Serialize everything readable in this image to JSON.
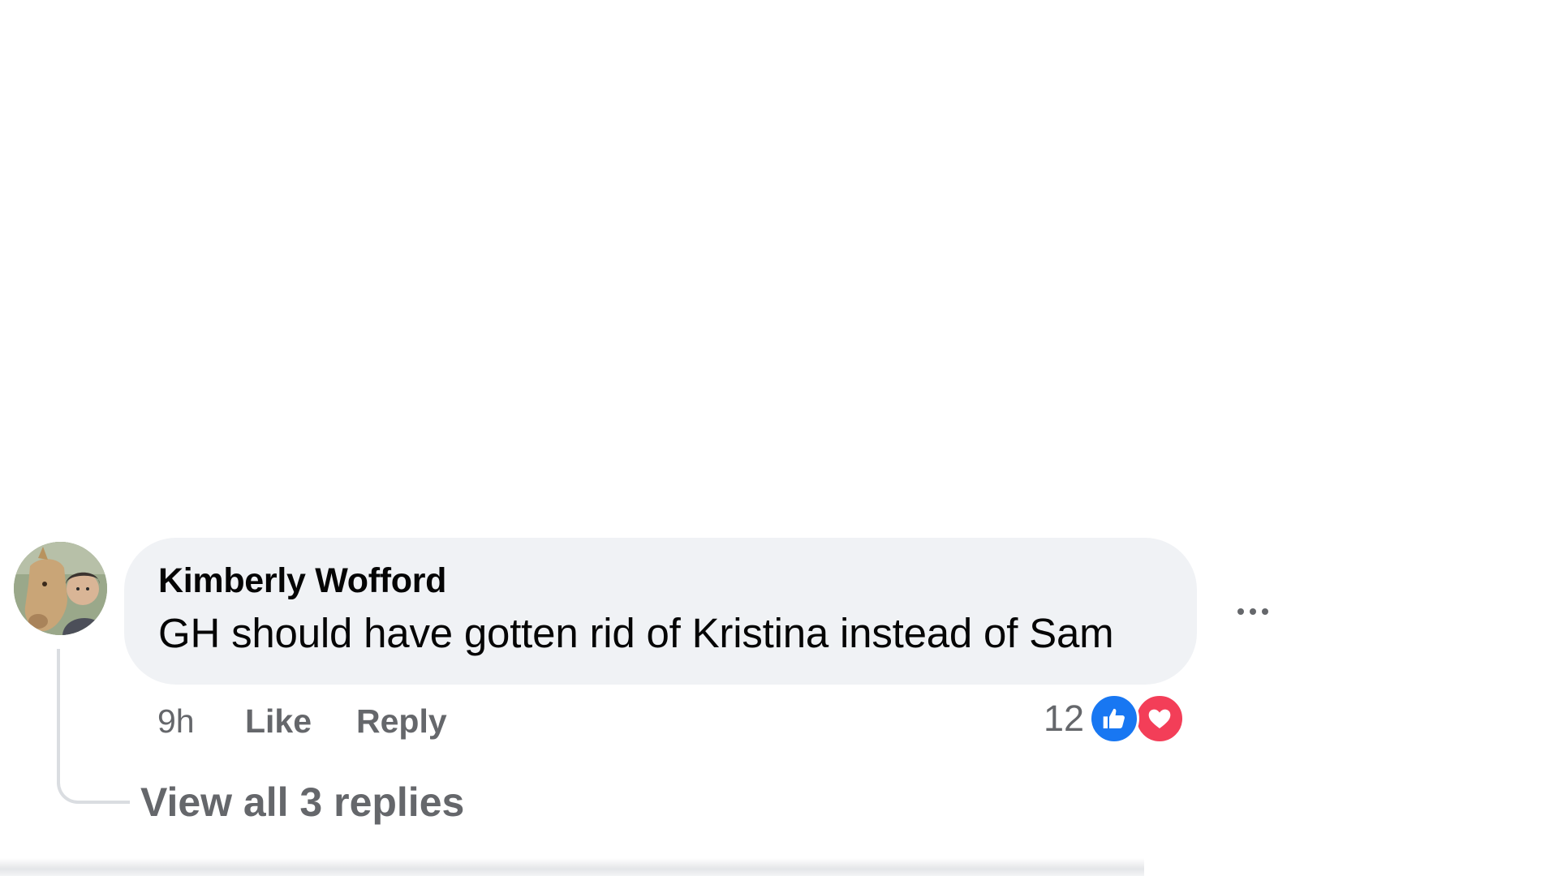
{
  "comment": {
    "author": "Kimberly Wofford",
    "text": "GH should have gotten rid of Kristina instead of Sam",
    "time": "9h",
    "like_label": "Like",
    "reply_label": "Reply",
    "reaction_count": "12",
    "reaction_icons": [
      "like-icon",
      "love-icon"
    ],
    "view_replies_label": "View all 3 replies",
    "more_icon": "more-options-icon"
  },
  "colors": {
    "bubble": "#f0f2f5",
    "secondary_text": "#65676b",
    "primary_text": "#050505",
    "like_blue": "#1877f2",
    "love_red": "#f33e58"
  }
}
